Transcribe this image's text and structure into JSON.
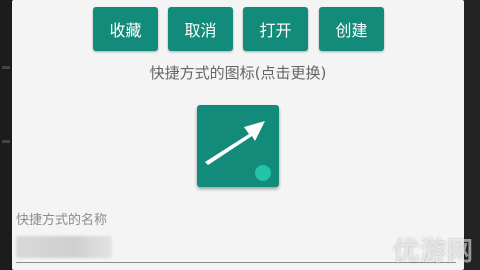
{
  "toolbar": {
    "favorite_label": "收藏",
    "cancel_label": "取消",
    "open_label": "打开",
    "create_label": "创建"
  },
  "icon_section": {
    "title": "快捷方式的图标(点击更换)",
    "icon_name": "shortcut-arrow-icon"
  },
  "name_field": {
    "label": "快捷方式的名称",
    "value": ""
  },
  "watermark": {
    "text": "优游网"
  },
  "colors": {
    "accent": "#138b7a",
    "badge": "#20c4a6",
    "dialog_bg": "#f4f4f4"
  }
}
